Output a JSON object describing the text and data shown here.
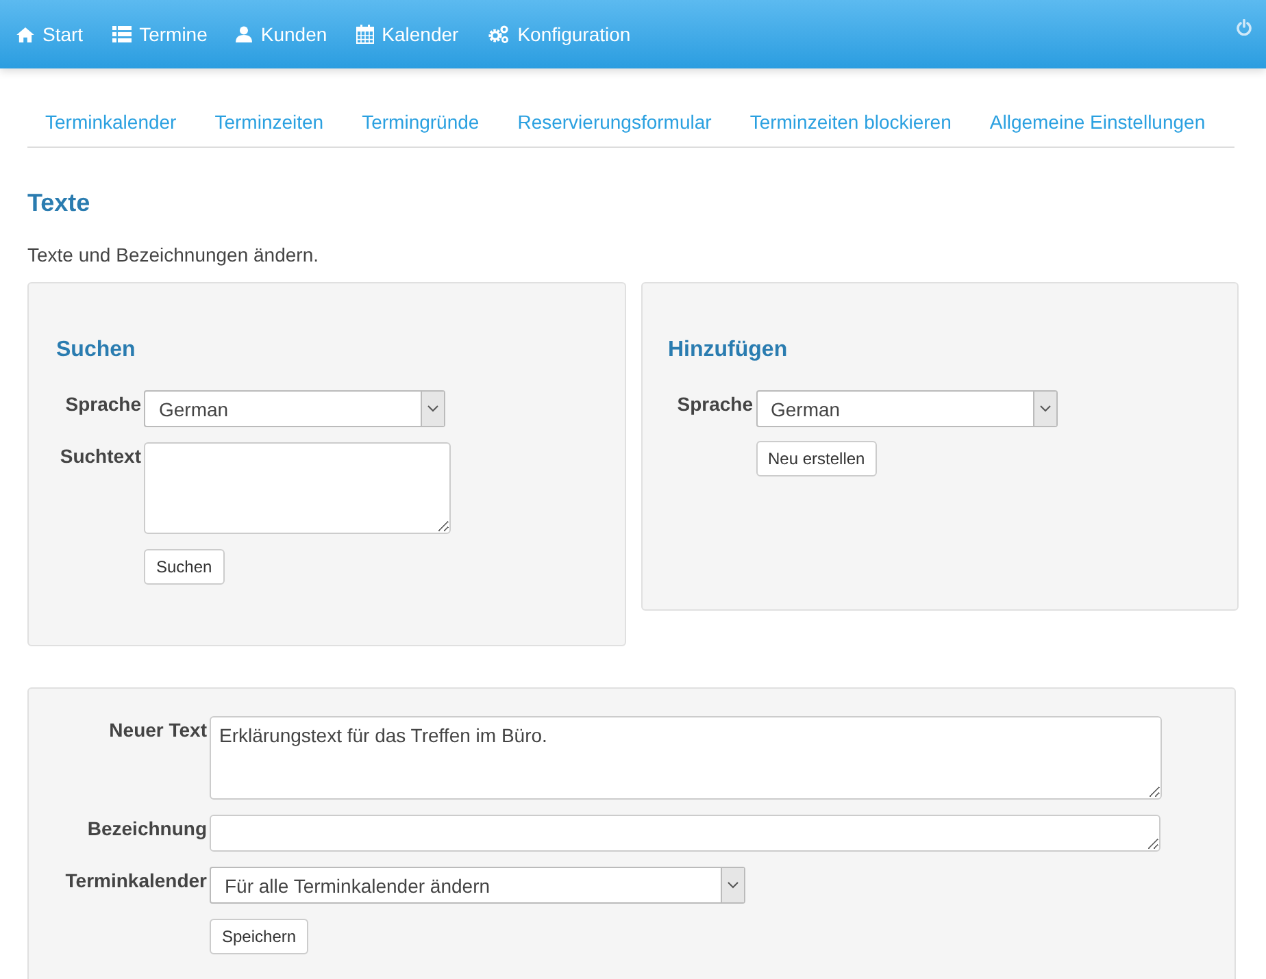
{
  "navbar": {
    "items": [
      {
        "label": "Start"
      },
      {
        "label": "Termine"
      },
      {
        "label": "Kunden"
      },
      {
        "label": "Kalender"
      },
      {
        "label": "Konfiguration"
      }
    ]
  },
  "subnav": {
    "items": [
      {
        "label": "Terminkalender"
      },
      {
        "label": "Terminzeiten"
      },
      {
        "label": "Termingründe"
      },
      {
        "label": "Reservierungsformular"
      },
      {
        "label": "Terminzeiten blockieren"
      },
      {
        "label": "Allgemeine Einstellungen"
      }
    ]
  },
  "page": {
    "title": "Texte",
    "description": "Texte und Bezeichnungen ändern."
  },
  "search_panel": {
    "title": "Suchen",
    "language_label": "Sprache",
    "language_value": "German",
    "search_label": "Suchtext",
    "button": "Suchen"
  },
  "add_panel": {
    "title": "Hinzufügen",
    "language_label": "Sprache",
    "language_value": "German",
    "button": "Neu erstellen"
  },
  "edit_panel": {
    "new_text_label": "Neuer Text",
    "new_text_value": "Erklärungstext für das Treffen im Büro.",
    "name_label": "Bezeichnung",
    "calendar_label": "Terminkalender",
    "calendar_value": "Für alle Terminkalender ändern",
    "button": "Speichern"
  }
}
